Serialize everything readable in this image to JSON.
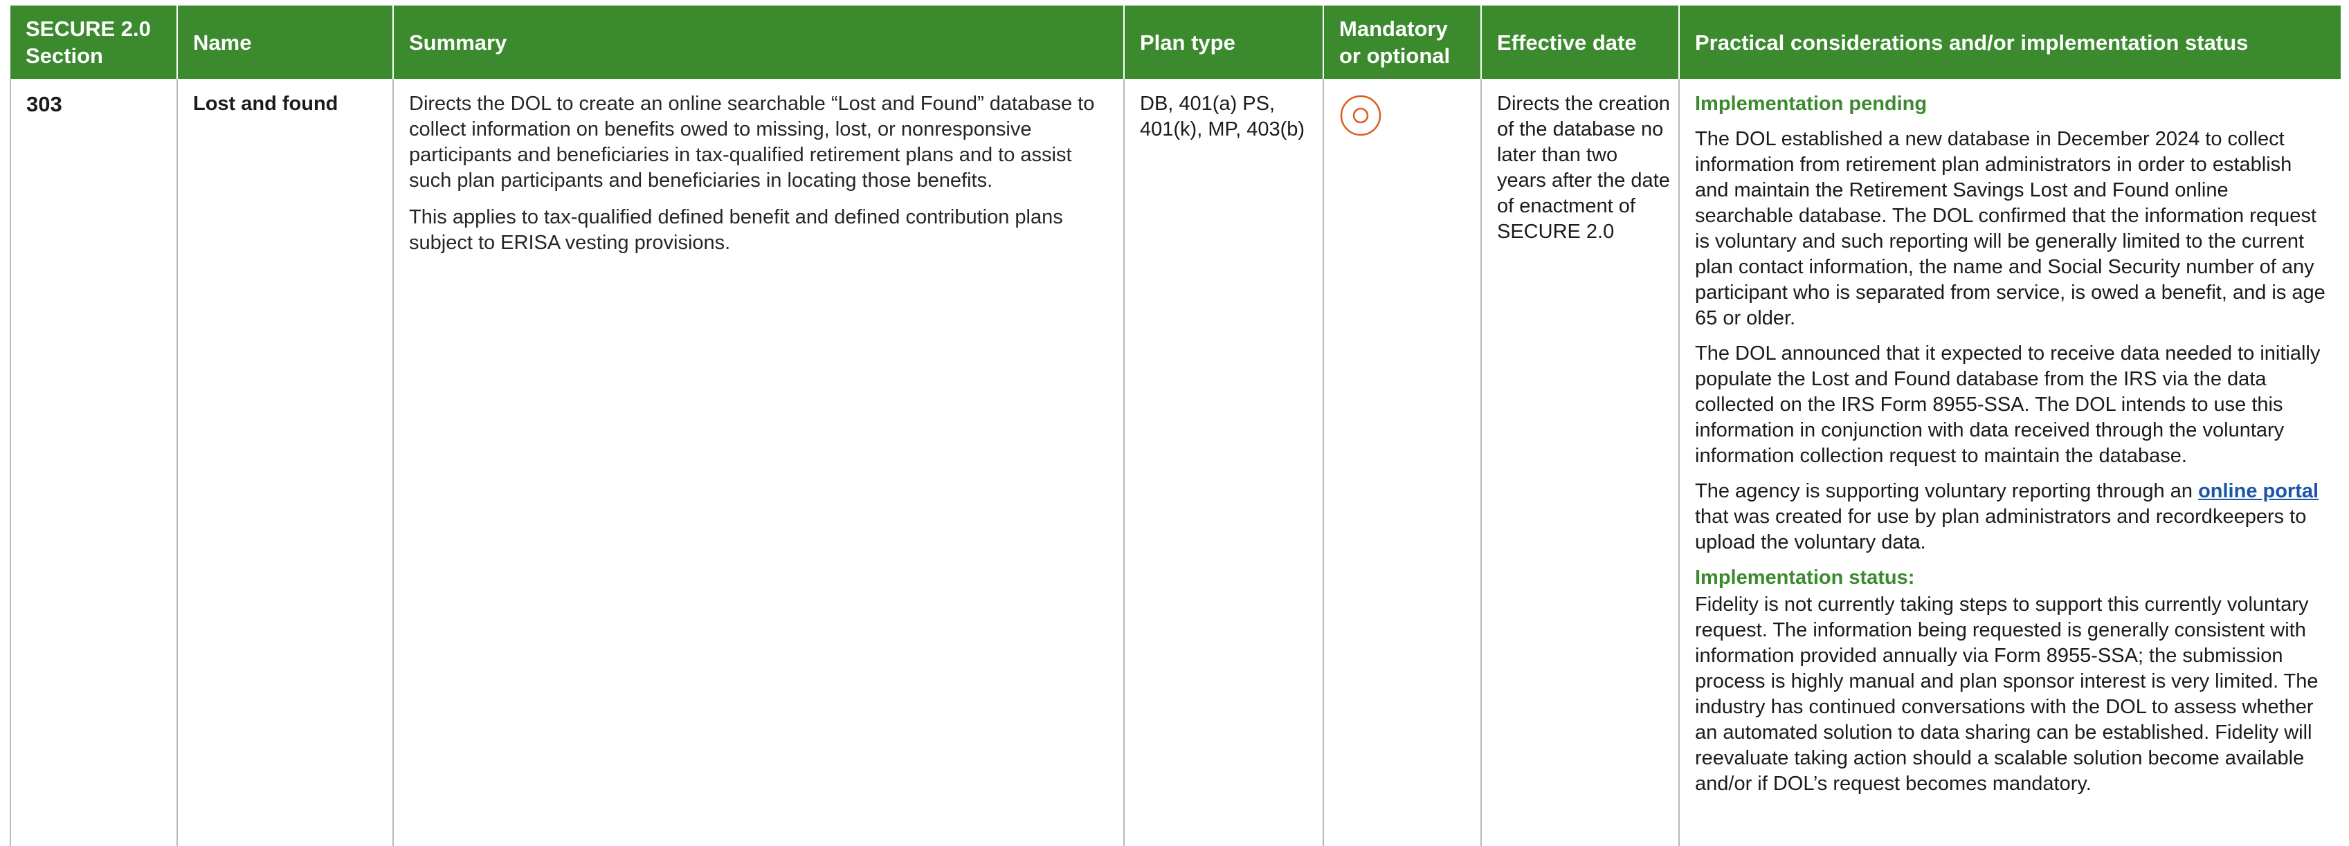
{
  "header": {
    "section": "SECURE 2.0 Section",
    "name": "Name",
    "summary": "Summary",
    "plan_type": "Plan type",
    "mandatory": "Mandatory or optional",
    "effective": "Effective date",
    "practical": "Practical considerations and/or implementation status"
  },
  "row": {
    "section": "303",
    "name": "Lost and found",
    "summary_p1": "Directs the DOL to create an online searchable “Lost and Found” database to collect information on benefits owed to missing, lost, or nonresponsive participants and beneficiaries in tax-qualified retirement plans and to assist such plan participants and beneficiaries in locating those benefits.",
    "summary_p2": "This applies to tax-qualified defined benefit and defined contribution plans subject to ERISA vesting provisions.",
    "plan_type": "DB, 401(a) PS, 401(k), MP, 403(b)",
    "mandatory_icon": "optional-circle-icon",
    "effective_date": "Directs the creation of the database no later than two years after the date of enactment of SECURE 2.0",
    "pending_heading": "Implementation pending",
    "practical_p1": "The DOL established a new database in December 2024 to collect information from retirement plan administrators in order to establish and maintain the Retirement Savings Lost and Found online searchable database. The DOL confirmed that the information request is voluntary and such reporting will be generally limited to the current plan contact information, the name and Social Security number of any participant who is separated from service, is owed a benefit, and is age 65 or older.",
    "practical_p2": "The DOL announced that it expected to receive data needed to initially populate the Lost and Found database from the IRS via the data collected on the IRS Form 8955-SSA. The DOL intends to use this information in conjunction with data received through the voluntary information collection request to maintain the database.",
    "practical_p3_before": "The agency is supporting voluntary reporting through an ",
    "practical_p3_link": "online portal",
    "practical_p3_after": " that was created for use by plan administrators and recordkeepers to upload the voluntary data.",
    "status_heading": "Implementation status:",
    "status_text": "Fidelity is not currently taking steps to support this currently voluntary request. The information being requested is generally consistent with information provided annually via Form 8955-SSA; the submission process is highly manual and plan sponsor interest is very limited. The industry has continued conversations with the DOL to assess whether an automated solution to data sharing can be established. Fidelity will reevaluate taking action should a scalable solution become available and/or if DOL’s request becomes mandatory."
  },
  "colors": {
    "header_green": "#3b8a2e",
    "icon_orange": "#e05a1c",
    "link_blue": "#1a56a6"
  }
}
